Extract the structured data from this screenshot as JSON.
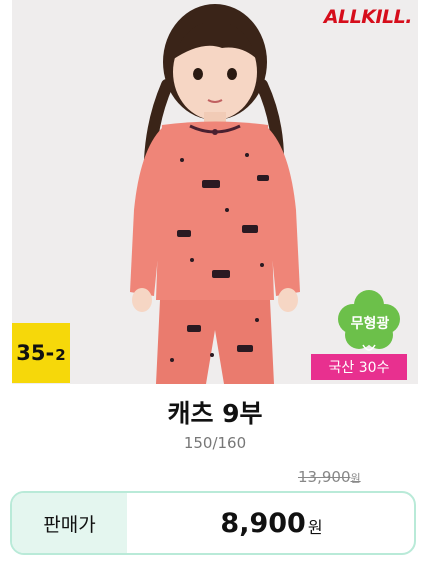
{
  "brand": {
    "logo_text": "ALLKILL."
  },
  "product": {
    "image_label": "child-pajama-photo",
    "name": "캐츠 9부",
    "sizes": "150/160"
  },
  "badges": {
    "size_code_main": "35-",
    "size_code_sub": "2",
    "cotton_label": "무형광",
    "origin_label": "국산 30수"
  },
  "pricing": {
    "original_price": "13,900",
    "original_unit": "원",
    "sale_label": "판매가",
    "sale_price": "8,900",
    "sale_unit": "원"
  },
  "colors": {
    "brand_red": "#d60d1b",
    "badge_yellow": "#f6d80a",
    "origin_pink": "#e8308f",
    "cotton_green": "#6cc04a",
    "price_border": "#b9ead8",
    "price_label_bg": "#e4f6ef",
    "pajama_coral": "#ef8578"
  }
}
